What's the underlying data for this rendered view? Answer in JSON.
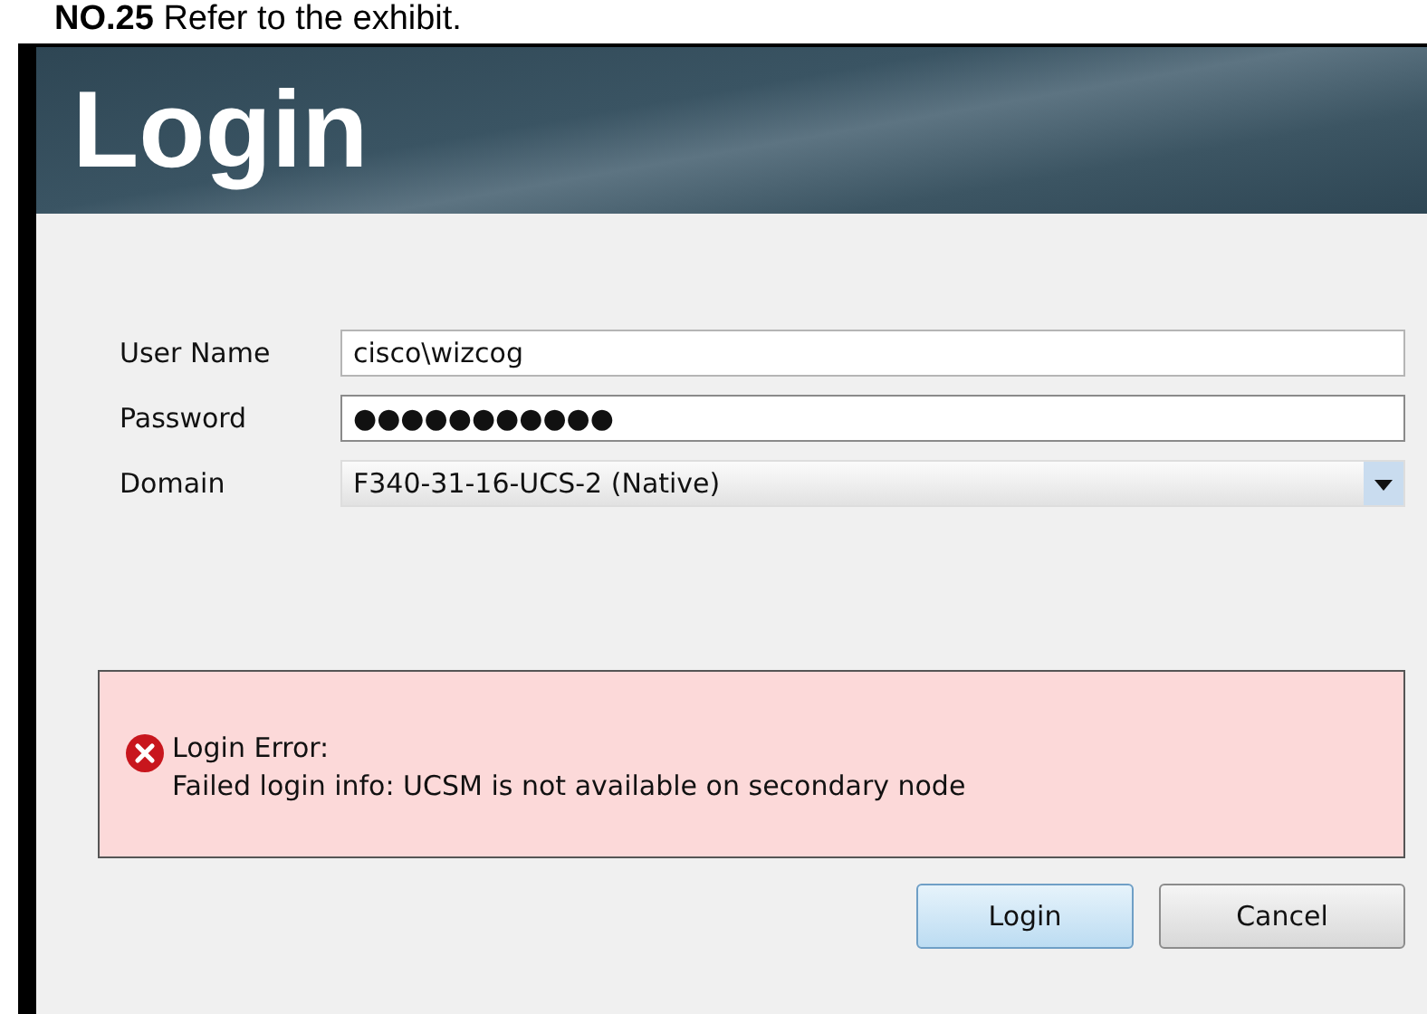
{
  "caption": "**NO.25** Refer to the exhibit.",
  "dialog": {
    "title": "Login",
    "fields": [
      {
        "kind": "text",
        "label": "User Name",
        "value": "cisco\\wizcog"
      },
      {
        "kind": "password",
        "label": "Password",
        "value": "●●●●●●●●●●●",
        "focused": true
      },
      {
        "kind": "select",
        "label": "Domain",
        "value": "F340-31-16-UCS-2 (Native)"
      }
    ],
    "error": {
      "title": "Login Error:",
      "message": "Failed login info: UCSM is not available on secondary node"
    },
    "buttons": [
      {
        "label": "Login",
        "default": true
      },
      {
        "label": "Cancel",
        "default": false
      }
    ]
  }
}
